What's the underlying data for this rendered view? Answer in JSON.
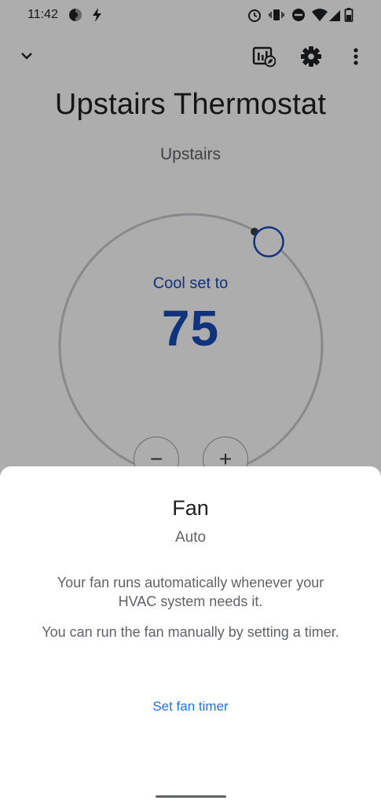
{
  "status_bar": {
    "time": "11:42",
    "icons": [
      "data-saver-icon",
      "charging-bolt-icon",
      "alarm-icon",
      "vibrate-icon",
      "do-not-disturb-icon",
      "wifi-icon",
      "cell-signal-icon",
      "battery-icon"
    ]
  },
  "app_bar": {
    "back_icon": "chevron-down-icon",
    "actions": [
      "energy-history-icon",
      "gear-icon",
      "more-vert-icon"
    ]
  },
  "device": {
    "name": "Upstairs Thermostat",
    "room": "Upstairs"
  },
  "thermostat": {
    "mode_label": "Cool set to",
    "setpoint": "75",
    "decrease_label": "−",
    "increase_label": "+",
    "accent_color": "#1a4bb8"
  },
  "fan_sheet": {
    "title": "Fan",
    "status": "Auto",
    "description_1": "Your fan runs automatically whenever your HVAC system needs it.",
    "description_2": "You can run the fan manually by setting a timer.",
    "action_label": "Set fan timer",
    "action_color": "#1a73e8"
  }
}
